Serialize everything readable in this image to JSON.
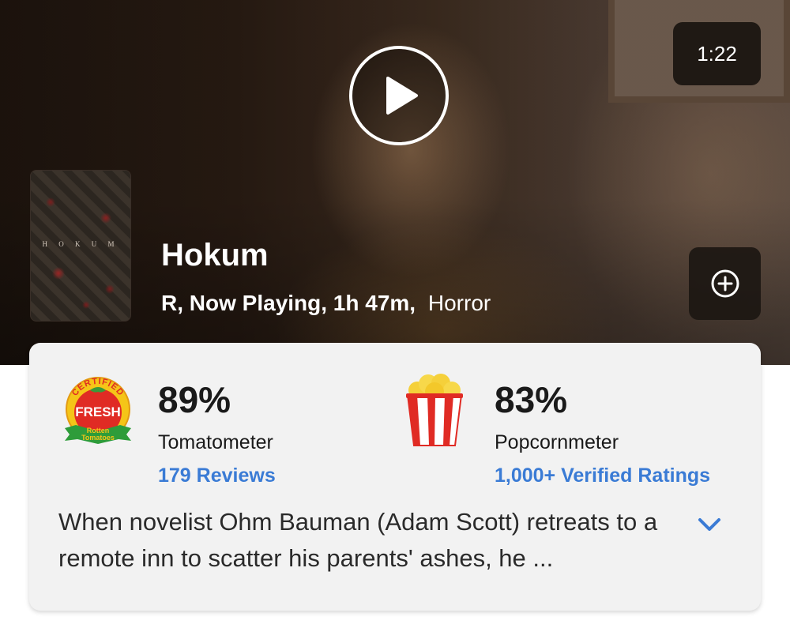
{
  "video": {
    "duration": "1:22"
  },
  "movie": {
    "title": "Hokum",
    "meta_main": "R, Now Playing, 1h 47m,",
    "genre": "Horror",
    "poster_title": "H O K U M"
  },
  "tomatometer": {
    "score": "89%",
    "label": "Tomatometer",
    "reviews_link": "179 Reviews",
    "badge": {
      "top_text": "CERTIFIED",
      "main_text": "FRESH",
      "bottom_text_1": "Rotten",
      "bottom_text_2": "Tomatoes"
    }
  },
  "popcornmeter": {
    "score": "83%",
    "label": "Popcornmeter",
    "ratings_link": "1,000+ Verified Ratings"
  },
  "synopsis": {
    "text": "When novelist Ohm Bauman (Adam Scott) retreats to a remote inn to scatter his parents' ashes, he ..."
  },
  "icons": {
    "play": "play-icon",
    "add": "plus-circle-icon",
    "expand": "chevron-down-icon"
  },
  "colors": {
    "link": "#3a7bd5",
    "fresh_red": "#e02b24",
    "badge_yellow": "#f5c518",
    "banner_green": "#2e9c3a"
  }
}
